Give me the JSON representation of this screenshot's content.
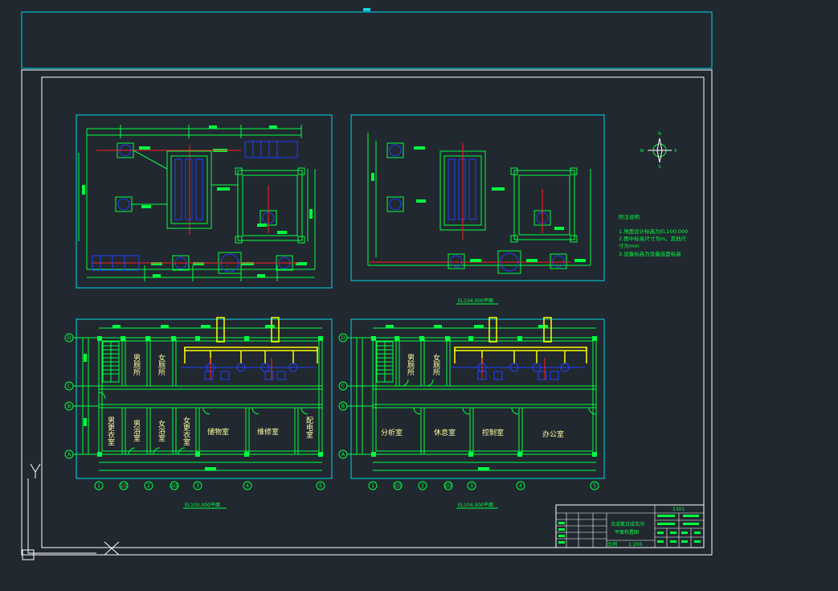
{
  "colors": {
    "background": "#212830",
    "cyan": "#00d8e8",
    "white": "#ffffff",
    "green": "#00ff40",
    "yellow": "#ffff00",
    "blue": "#2040ff",
    "red": "#ff2020",
    "pale_yellow": "#ffffa0"
  },
  "plans": {
    "top_left_label": "EL100.000平面",
    "top_right_label": "EL104.000平面",
    "bottom_left_label": "EL100.000平面",
    "bottom_right_label": "EL104.000平面"
  },
  "rooms_left": {
    "men_toilet": "男厕所",
    "women_toilet": "女厕所",
    "men_locker": "男更衣室",
    "men_bath": "男浴室",
    "women_bath": "女浴室",
    "women_locker": "女更衣室",
    "storage": "储物室",
    "repair": "维修室",
    "power": "配电室"
  },
  "rooms_right": {
    "men_toilet": "男厕所",
    "women_toilet": "女厕所",
    "analysis": "分析室",
    "rest": "休息室",
    "control": "控制室",
    "office": "办公室"
  },
  "axes_rows": [
    "D",
    "C",
    "B",
    "A"
  ],
  "axes_cols_left": [
    "1",
    "1/1",
    "2",
    "2/2",
    "3",
    "4",
    "5"
  ],
  "axes_cols_right": [
    "1",
    "1/1",
    "2",
    "2/2",
    "3",
    "4",
    "5"
  ],
  "notes": {
    "title": "附注说明",
    "line1": "1.地面设计标高为EL100.000",
    "line2": "2.图中标高尺寸为m，其他尺",
    "line3": "  寸为mm",
    "line4": "3.设备标高为设备底面标高"
  },
  "compass": {
    "north": "N",
    "east": "E",
    "west": "W",
    "south": "S"
  },
  "title_block": {
    "project": "合成氨合成车间",
    "drawing": "平面布置图",
    "sheet": "1301",
    "scale_label": "比例",
    "scale": "1:200"
  }
}
